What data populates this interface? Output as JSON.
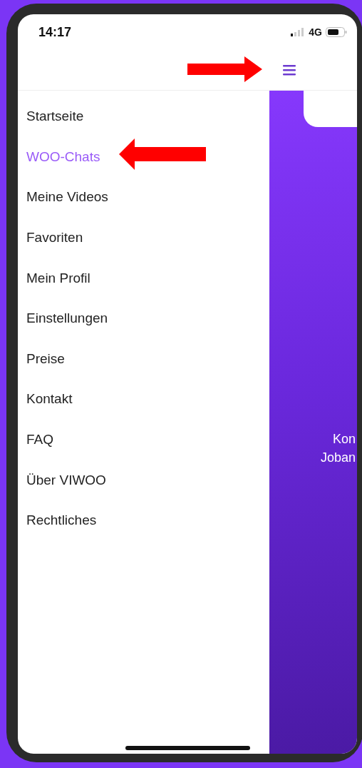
{
  "status_bar": {
    "time": "14:17",
    "network": "4G"
  },
  "menu": {
    "items": [
      {
        "label": "Startseite",
        "selected": false
      },
      {
        "label": "WOO-Chats",
        "selected": true
      },
      {
        "label": "Meine Videos",
        "selected": false
      },
      {
        "label": "Favoriten",
        "selected": false
      },
      {
        "label": "Mein Profil",
        "selected": false
      },
      {
        "label": "Einstellungen",
        "selected": false
      },
      {
        "label": "Preise",
        "selected": false
      },
      {
        "label": "Kontakt",
        "selected": false
      },
      {
        "label": "FAQ",
        "selected": false
      },
      {
        "label": "Über VIWOO",
        "selected": false
      },
      {
        "label": "Rechtliches",
        "selected": false
      }
    ]
  },
  "content": {
    "lines": [
      "Kon",
      "Joban"
    ]
  }
}
